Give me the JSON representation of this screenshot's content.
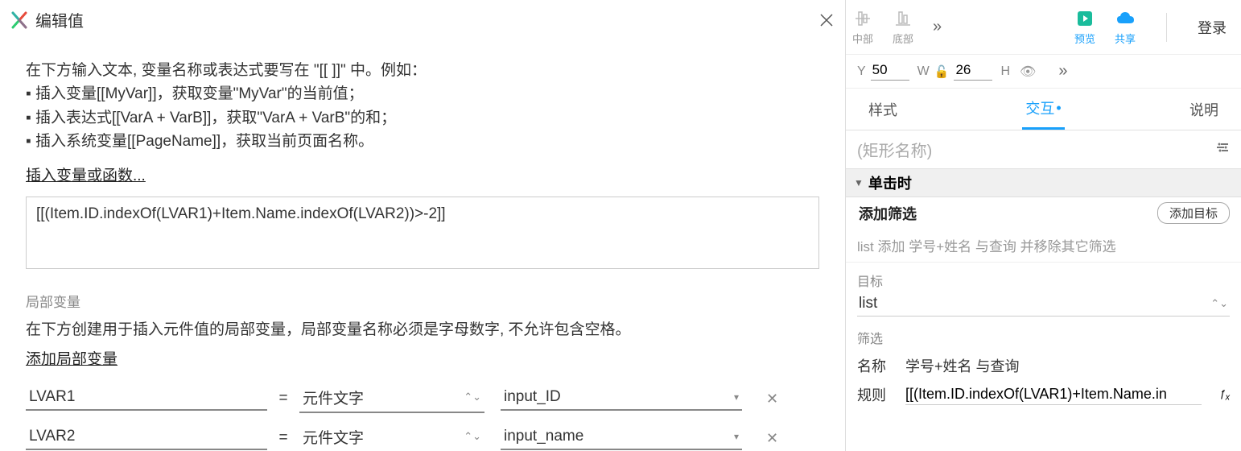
{
  "dialog": {
    "title": "编辑值",
    "hints": {
      "intro": "在下方输入文本, 变量名称或表达式要写在 \"[[ ]]\" 中。例如：",
      "b1": "插入变量[[MyVar]]，获取变量\"MyVar\"的当前值；",
      "b2": "插入表达式[[VarA + VarB]]，获取\"VarA + VarB\"的和；",
      "b3": "插入系统变量[[PageName]]，获取当前页面名称。"
    },
    "insert_link": "插入变量或函数...",
    "expression": "[[(Item.ID.indexOf(LVAR1)+Item.Name.indexOf(LVAR2))>-2]]",
    "locals_label": "局部变量",
    "locals_hint": "在下方创建用于插入元件值的局部变量，局部变量名称必须是字母数字, 不允许包含空格。",
    "add_local": "添加局部变量",
    "rows": [
      {
        "name": "LVAR1",
        "source": "元件文字",
        "target": "input_ID"
      },
      {
        "name": "LVAR2",
        "source": "元件文字",
        "target": "input_name"
      }
    ]
  },
  "toolbar": {
    "items": {
      "mid": "中部",
      "bottom": "底部",
      "preview": "预览",
      "share": "共享"
    },
    "login": "登录"
  },
  "props": {
    "y_label": "Y",
    "y_value": "50",
    "w_label": "W",
    "w_value": "26",
    "h_label": "H"
  },
  "tabs": {
    "style": "样式",
    "inter": "交互",
    "notes": "说明"
  },
  "shape_placeholder": "(矩形名称)",
  "event": "单击时",
  "action": {
    "label": "添加筛选",
    "btn": "添加目标"
  },
  "filter_summary": "list 添加 学号+姓名 与查询 并移除其它筛选",
  "target": {
    "label": "目标",
    "value": "list"
  },
  "filter": {
    "label": "筛选",
    "name_k": "名称",
    "name_v": "学号+姓名 与查询",
    "rule_k": "规则",
    "rule_v": "[[(Item.ID.indexOf(LVAR1)+Item.Name.in"
  }
}
